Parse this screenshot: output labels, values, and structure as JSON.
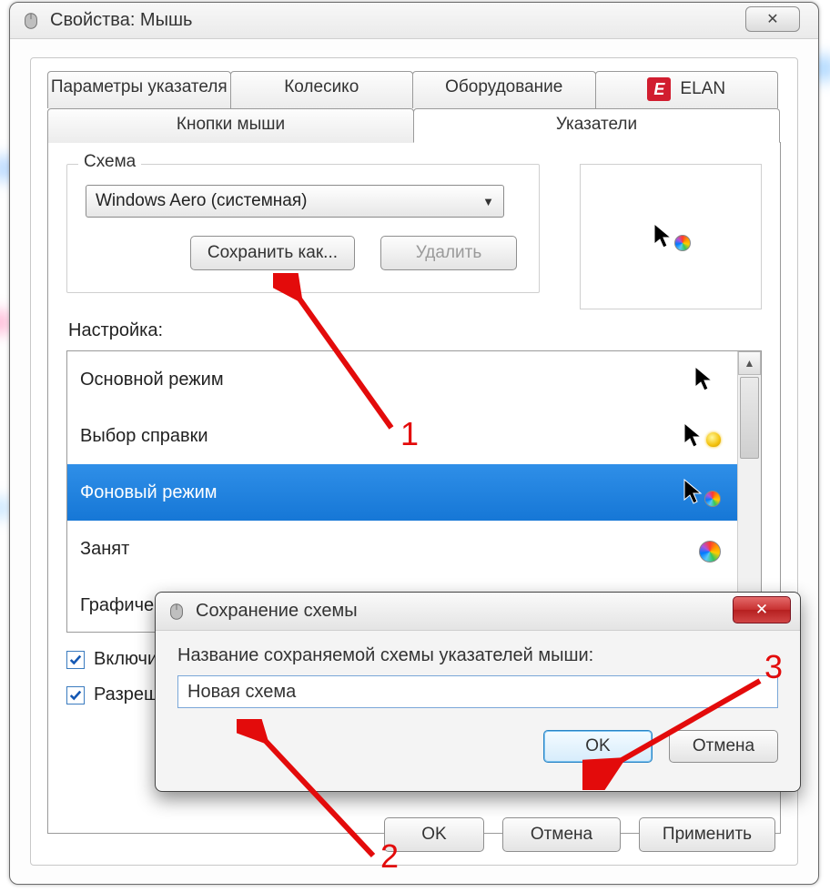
{
  "window": {
    "title": "Свойства: Мышь",
    "close_glyph": "✕"
  },
  "tabs": {
    "row1": [
      "Параметры указателя",
      "Колесико",
      "Оборудование",
      "ELAN"
    ],
    "row2": [
      "Кнопки мыши",
      "Указатели"
    ],
    "active": "Указатели"
  },
  "scheme_group": {
    "legend": "Схема",
    "selected": "Windows Aero (системная)",
    "save_as": "Сохранить как...",
    "delete": "Удалить"
  },
  "settings_label": "Настройка:",
  "pointer_list": [
    {
      "label": "Основной режим",
      "icon": "arrow"
    },
    {
      "label": "Выбор справки",
      "icon": "arrow-help"
    },
    {
      "label": "Фоновый режим",
      "icon": "arrow-busy",
      "selected": true
    },
    {
      "label": "Занят",
      "icon": "busy"
    },
    {
      "label": "Графическ",
      "icon": "cross"
    }
  ],
  "checkboxes": {
    "enable_shadow": {
      "label": "Включить",
      "checked": true
    },
    "allow_themes": {
      "label": "Разреши",
      "checked": true
    }
  },
  "buttons": {
    "ok": "OK",
    "cancel": "Отмена",
    "apply": "Применить"
  },
  "dialog": {
    "title": "Сохранение схемы",
    "prompt": "Название сохраняемой схемы указателей мыши:",
    "value": "Новая схема",
    "ok": "OK",
    "cancel": "Отмена"
  },
  "annotations": {
    "n1": "1",
    "n2": "2",
    "n3": "3"
  }
}
